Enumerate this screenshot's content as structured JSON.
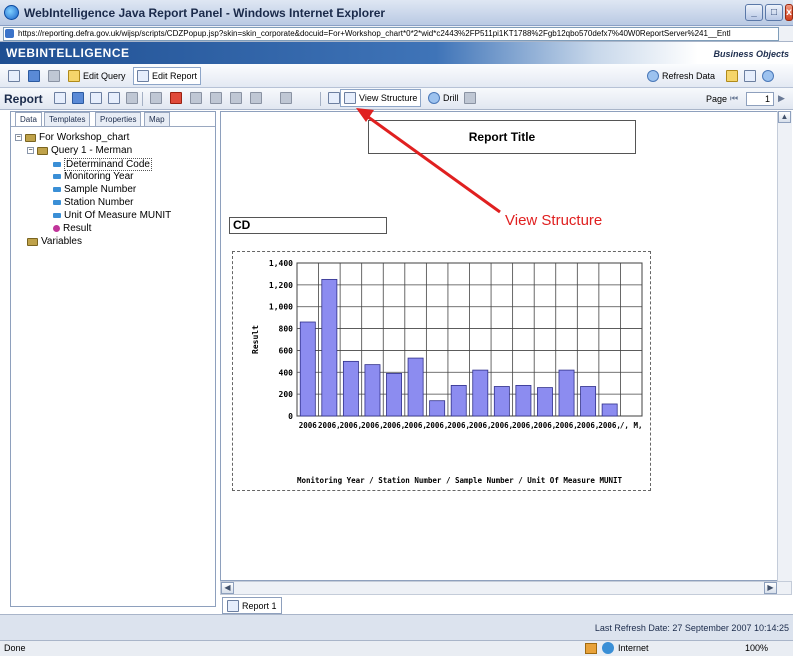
{
  "window": {
    "title": "WebIntelligence Java Report Panel - Windows Internet Explorer",
    "url": "https://reporting.defra.gov.uk/wijsp/scripts/CDZPopup.jsp?skin=skin_corporate&docuid=For+Workshop_chart*0*2*wid*c2443%2FP511pi1KT1788%2Fgb12qbo570defx7%40W0ReportServer%241__Entl"
  },
  "app": {
    "logo": "WEBINTELLIGENCE",
    "brand": "Business Objects"
  },
  "toolbar1": {
    "edit_query": "Edit Query",
    "edit_report": "Edit Report",
    "refresh_data": "Refresh Data"
  },
  "toolbar2": {
    "report_label": "Report",
    "view_structure": "View Structure",
    "drill": "Drill",
    "page_label": "Page",
    "page_number": "1"
  },
  "left_panel": {
    "tabs": [
      "Data",
      "Templates",
      "Properties",
      "Map"
    ],
    "tree": {
      "root": "For Workshop_chart",
      "query": "Query 1 - Merman",
      "objects": [
        "Determinand Code",
        "Monitoring Year",
        "Sample Number",
        "Station Number",
        "Unit Of Measure MUNIT",
        "Result"
      ],
      "variables": "Variables"
    }
  },
  "report": {
    "title_cell": "Report Title",
    "cd_cell": "CD",
    "annotation": "View Structure",
    "tab_name": "Report 1"
  },
  "chart_data": {
    "type": "bar",
    "categories": [
      "2006",
      "2006,",
      "2006,",
      "2006,",
      "2006,",
      "2006,",
      "2006,",
      "2006,",
      "2006,",
      "2006,",
      "2006,",
      "2006,",
      "2006,",
      "2006,",
      "2006,",
      "/, M,"
    ],
    "series": [
      {
        "values": [
          860,
          1250,
          500,
          470,
          390,
          530,
          140,
          280,
          420,
          270,
          280,
          260,
          420,
          270,
          110
        ]
      }
    ],
    "ylabel": "Result",
    "xlabel": "Monitoring Year / Station Number / Sample Number / Unit Of Measure MUNIT",
    "ylim": [
      0,
      1400
    ],
    "yticks": [
      "0",
      "200",
      "400",
      "600",
      "800",
      "1,000",
      "1,200",
      "1,400"
    ],
    "grid": true,
    "bar_color": "#8c8cf0"
  },
  "status": {
    "last_refresh": "Last Refresh Date: 27 September 2007 10:14:25",
    "left": "Done",
    "zone": "Internet",
    "zoom": "100%"
  }
}
